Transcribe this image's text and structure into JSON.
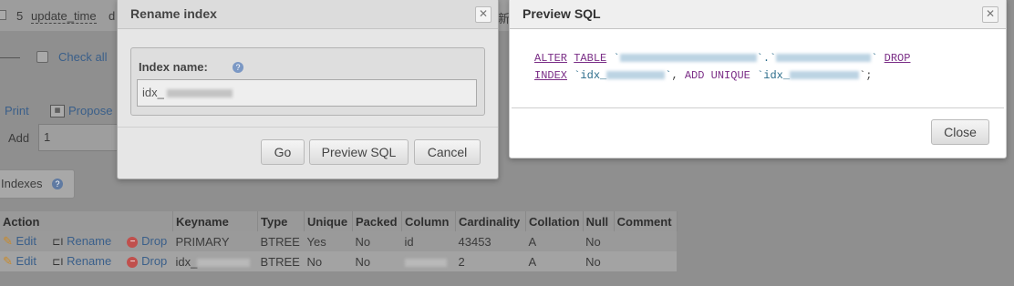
{
  "background": {
    "top_row": {
      "number": "5",
      "field": "update_time",
      "tail": "d",
      "side_char": "新"
    },
    "check_all": "Check all",
    "toolbar": {
      "print": "Print",
      "propose": "Propose"
    },
    "add": {
      "label": "Add",
      "value": "1"
    },
    "indexes": {
      "label": "Indexes"
    },
    "table": {
      "headers": [
        "Action",
        "Keyname",
        "Type",
        "Unique",
        "Packed",
        "Column",
        "Cardinality",
        "Collation",
        "Null",
        "Comment"
      ],
      "action_labels": {
        "edit": "Edit",
        "rename": "Rename",
        "drop": "Drop"
      },
      "rows": [
        {
          "keyname": "PRIMARY",
          "type": "BTREE",
          "unique": "Yes",
          "packed": "No",
          "column": "id",
          "cardinality": "43453",
          "collation": "A",
          "null": "No",
          "comment": ""
        },
        {
          "keyname": "idx_",
          "type": "BTREE",
          "unique": "No",
          "packed": "No",
          "column": "",
          "cardinality": "2",
          "collation": "A",
          "null": "No",
          "comment": ""
        }
      ]
    }
  },
  "rename_dialog": {
    "title": "Rename index",
    "field_label": "Index name:",
    "field_value": "idx_",
    "buttons": {
      "go": "Go",
      "preview": "Preview SQL",
      "cancel": "Cancel"
    }
  },
  "preview_dialog": {
    "title": "Preview SQL",
    "sql": {
      "alter": "ALTER",
      "table": "TABLE",
      "drop": "DROP",
      "index": "INDEX",
      "idx_prefix": "idx_",
      "add": "ADD",
      "unique": "UNIQUE",
      "idx_prefix2": "idx_",
      "end": "`;"
    },
    "close_label": "Close"
  },
  "colors": {
    "keyword": "#7a2d86",
    "identifier": "#2b6c8a",
    "link": "#3a5f8a"
  }
}
